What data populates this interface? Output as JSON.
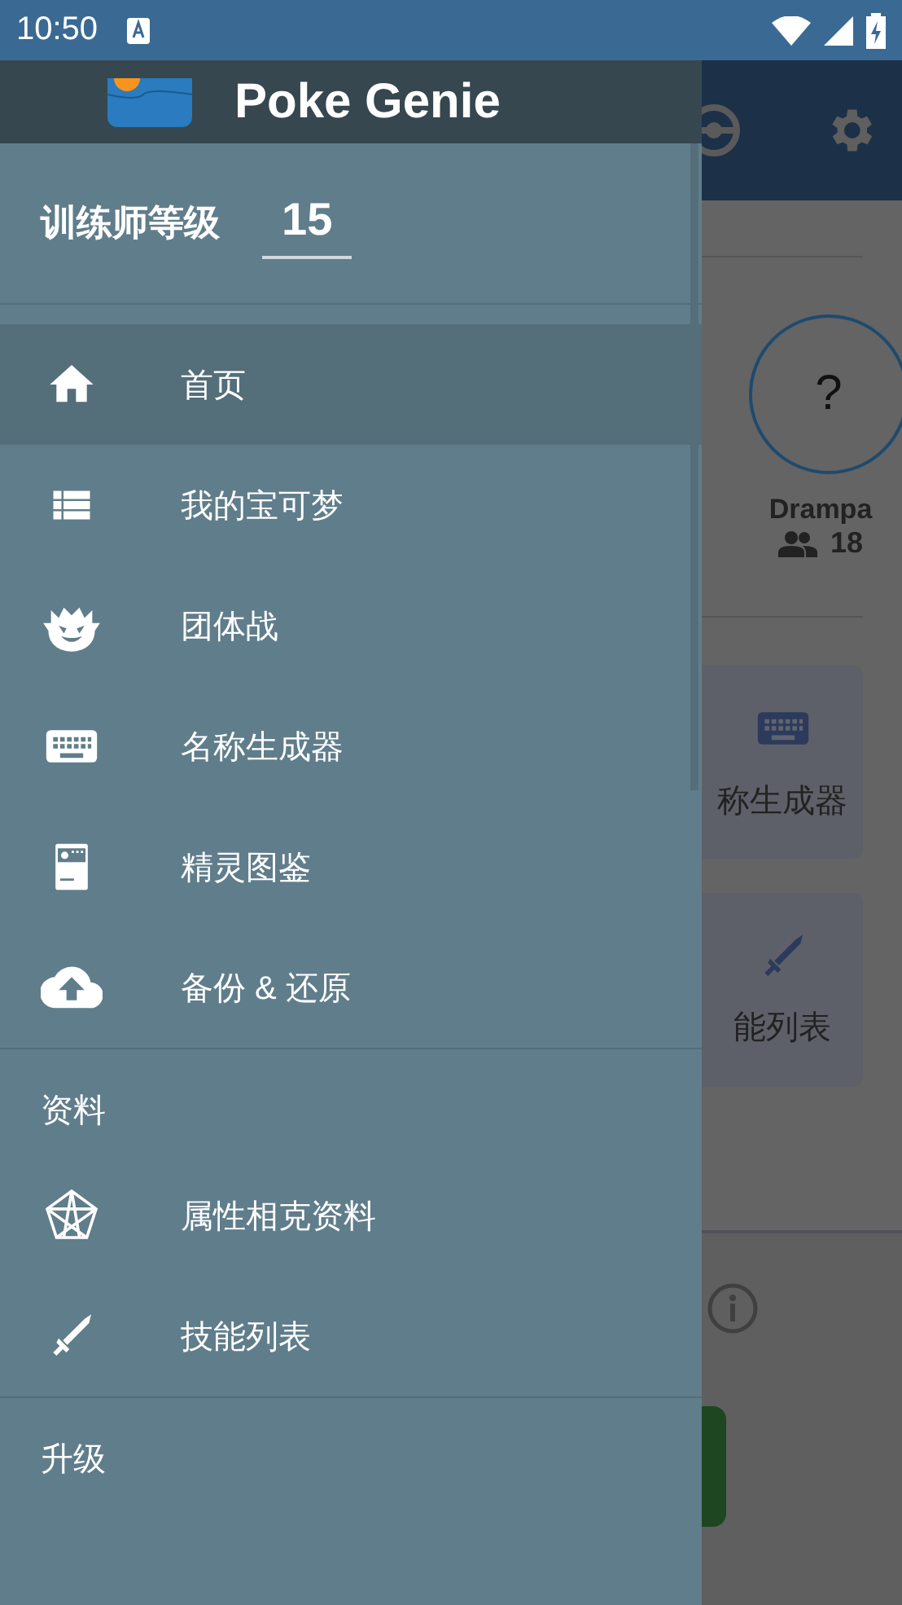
{
  "status_bar": {
    "time": "10:50"
  },
  "drawer": {
    "app_name": "Poke Genie",
    "trainer_level": {
      "label": "训练师等级",
      "value": "15"
    },
    "sections": [
      {
        "items": [
          {
            "label": "首页",
            "kind": "home",
            "selected": true
          },
          {
            "label": "我的宝可梦",
            "kind": "list",
            "selected": false
          },
          {
            "label": "团体战",
            "kind": "raid",
            "selected": false
          },
          {
            "label": "名称生成器",
            "kind": "keyboard",
            "selected": false
          },
          {
            "label": "精灵图鉴",
            "kind": "dex",
            "selected": false
          },
          {
            "label": "备份 & 还原",
            "kind": "cloud",
            "selected": false
          }
        ]
      },
      {
        "title": "资料",
        "items": [
          {
            "label": "属性相克资料",
            "kind": "pentagon",
            "selected": false
          },
          {
            "label": "技能列表",
            "kind": "sword",
            "selected": false
          }
        ]
      },
      {
        "title": "升级"
      }
    ]
  },
  "background_screen": {
    "pokemon": {
      "mark": "?",
      "name": "Drampa",
      "count": "18"
    },
    "cards": [
      {
        "label": "称生成器",
        "kind": "keyboard"
      },
      {
        "label": "能列表",
        "kind": "sword"
      }
    ]
  }
}
